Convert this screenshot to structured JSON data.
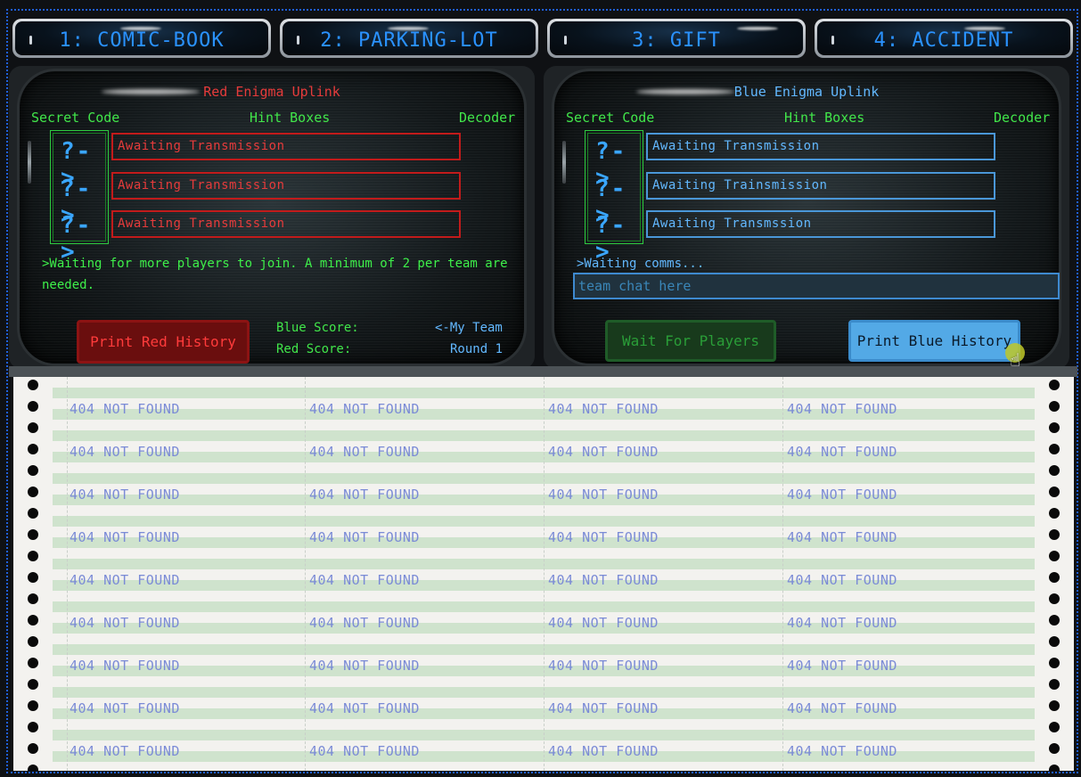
{
  "tabs": [
    "1: COMIC-BOOK",
    "2: PARKING-LOT",
    "3: GIFT",
    "4: ACCIDENT"
  ],
  "red": {
    "title": "Red Enigma Uplink",
    "headers": {
      "secret": "Secret Code",
      "hints": "Hint Boxes",
      "decoder": "Decoder"
    },
    "decoders": [
      "?->",
      "?->",
      "?->"
    ],
    "hints": [
      "Awaiting Transmission",
      "Awaiting Transmission",
      "Awaiting Transmission"
    ],
    "status": ">Waiting for more players to join. A minimum of 2 per team are needed.",
    "print_button": "Print Red History",
    "blue_score_label": "Blue Score:",
    "red_score_label": "Red Score:",
    "my_team": "<-My Team",
    "round": "Round 1"
  },
  "blue": {
    "title": "Blue Enigma Uplink",
    "headers": {
      "secret": "Secret Code",
      "hints": "Hint Boxes",
      "decoder": "Decoder"
    },
    "decoders": [
      "?->",
      "?->",
      "?->"
    ],
    "hints": [
      "Awaiting Transmission",
      "Awaiting Trainsmission",
      "Awaiting Transmssion"
    ],
    "status": ">Waiting comms...",
    "chat_placeholder": "team chat here",
    "wait_button": "Wait For Players",
    "print_button": "Print Blue History"
  },
  "printout": {
    "cell_text": "404 NOT FOUND",
    "rows": 9,
    "cols": 4
  },
  "colors": {
    "red": "#e63b3b",
    "blue": "#62b8ff",
    "green": "#41e64a",
    "tab": "#2a92ff"
  }
}
